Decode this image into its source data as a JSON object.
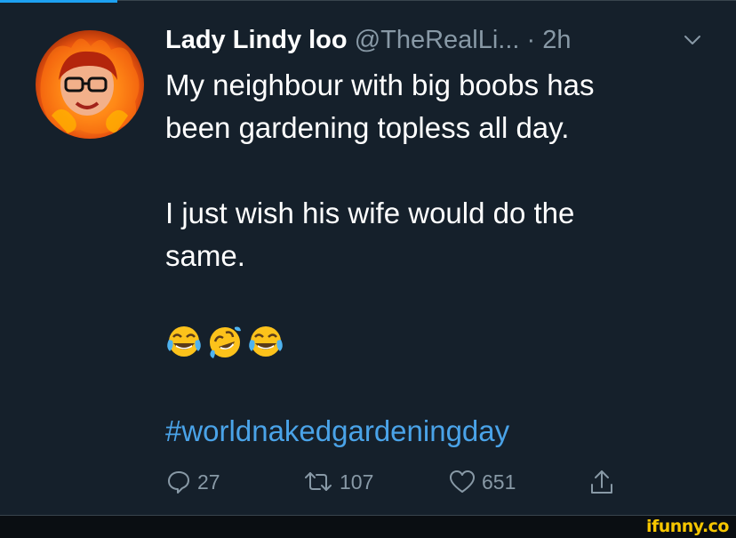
{
  "tweet": {
    "display_name": "Lady Lindy loo",
    "handle": "@TheRealLi...",
    "separator": "·",
    "timestamp": "2h",
    "text_line1": "My neighbour with big boobs has",
    "text_line2": "been gardening topless all day.",
    "text_line3": "I just wish his wife would do the",
    "text_line4": "same.",
    "emojis": [
      "face-with-tears-of-joy",
      "rolling-on-floor-laughing",
      "face-with-tears-of-joy"
    ],
    "hashtag": "#worldnakedgardeningday"
  },
  "actions": {
    "reply_count": "27",
    "retweet_count": "107",
    "like_count": "651"
  },
  "icons": {
    "reply": "speech-bubble-icon",
    "retweet": "retweet-icon",
    "like": "heart-icon",
    "share": "share-icon",
    "caret": "chevron-down-icon"
  },
  "colors": {
    "background": "#15202b",
    "text": "#ffffff",
    "muted": "#8899a6",
    "link": "#4aa3e8",
    "watermark": "#f6c600"
  },
  "watermark": "ifunny.co"
}
